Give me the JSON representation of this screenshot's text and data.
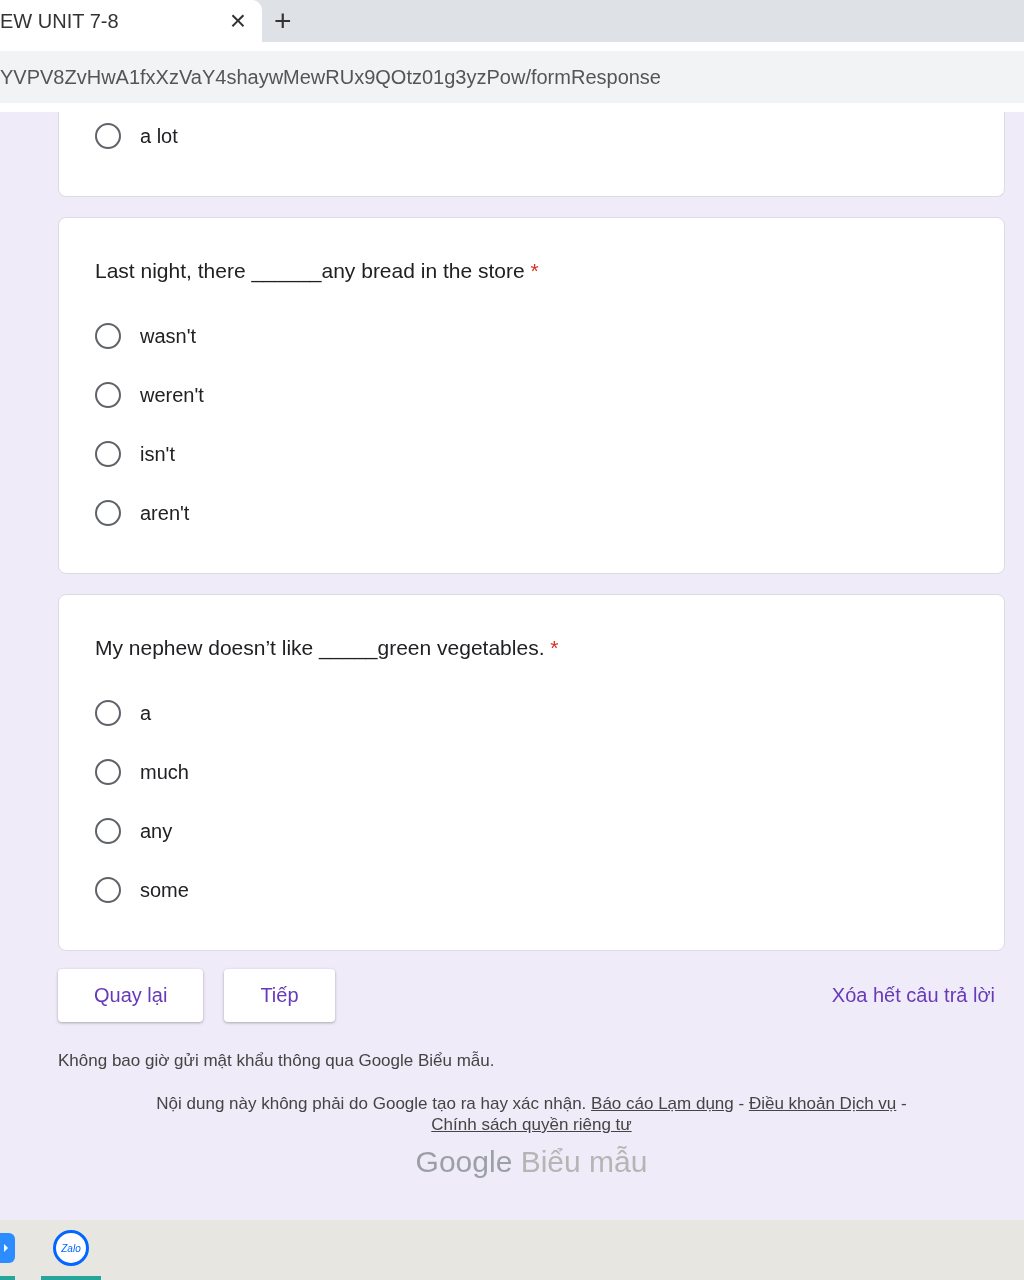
{
  "browser": {
    "tab_title": "EW UNIT 7-8",
    "close_glyph": "×",
    "new_tab_glyph": "+",
    "url": "YVPV8ZvHwA1fxXzVaY4shaywMewRUx9QOtz01g3yzPow/formResponse"
  },
  "questions": [
    {
      "options": [
        {
          "label": "a lot",
          "selected": false
        }
      ]
    },
    {
      "title": "Last night, there ______any bread in the store",
      "required_mark": "*",
      "options": [
        {
          "label": "wasn't",
          "selected": false
        },
        {
          "label": "weren't",
          "selected": false
        },
        {
          "label": "isn't",
          "selected": false
        },
        {
          "label": "aren't",
          "selected": false
        }
      ]
    },
    {
      "title": "My nephew doesn’t like _____green vegetables.",
      "required_mark": "*",
      "options": [
        {
          "label": "a",
          "selected": false
        },
        {
          "label": "much",
          "selected": false
        },
        {
          "label": "any",
          "selected": false
        },
        {
          "label": "some",
          "selected": false
        }
      ]
    }
  ],
  "nav_buttons": [
    "Quay lại",
    "Tiếp"
  ],
  "clear_link": "Xóa hết câu trả lời",
  "password_notice": "Không bao giờ gửi mật khẩu thông qua Google Biểu mẫu.",
  "disclaimer": {
    "text": "Nội dung này không phải do Google tạo ra hay xác nhận.",
    "links": [
      "Báo cáo Lạm dụng",
      "Điều khoản Dịch vụ",
      "Chính sách quyền riêng tư"
    ],
    "separator": "-"
  },
  "logo": {
    "brand": "Google",
    "product": "Biểu mẫu"
  },
  "taskbar": {
    "apps": [
      {
        "label": "Zalo"
      }
    ]
  }
}
